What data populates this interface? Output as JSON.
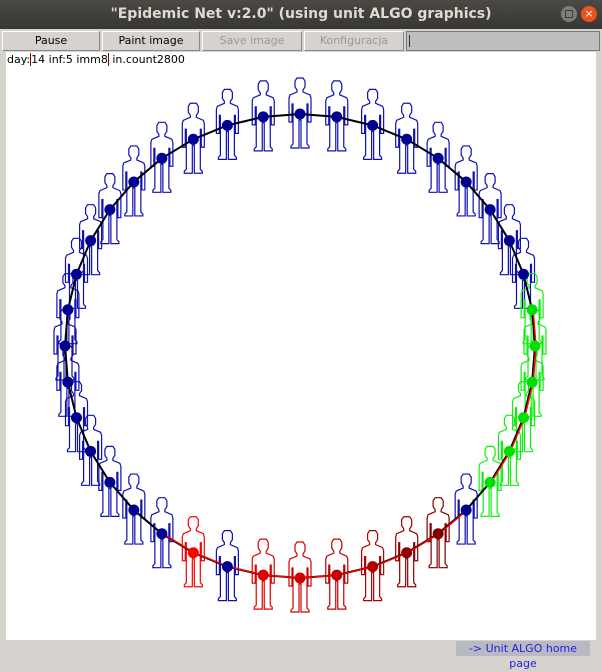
{
  "window": {
    "title": "\"Epidemic Net v:2.0\" (using unit ALGO graphics)",
    "close_glyph": "×"
  },
  "toolbar": {
    "pause_label": "Pause",
    "paint_label": "Paint image",
    "save_label": "Save image",
    "config_label": "Konfiguracja",
    "text_value": ""
  },
  "status": {
    "day_label": "day:",
    "day": "14",
    "inf": "inf:5",
    "imm": "imm8",
    "count": "in.count2800"
  },
  "footer": {
    "link": "-> Unit ALGO home page"
  },
  "colors": {
    "susceptible_outline": "#1010b0",
    "susceptible_dot": "#000090",
    "immune_outline": "#10f010",
    "immune_dot": "#00e000",
    "edge": "#000000",
    "infected_edge": "#ff0000"
  },
  "people": [
    "immune",
    "immune",
    "immune",
    "immune",
    "immune",
    "susceptible",
    "#800000",
    "#900000",
    "#b00000",
    "#c00000",
    "#d00000",
    "#e00000",
    "susceptible",
    "#ff0000",
    "susceptible",
    "susceptible",
    "susceptible",
    "susceptible",
    "susceptible",
    "susceptible",
    "susceptible",
    "susceptible",
    "susceptible",
    "susceptible",
    "susceptible",
    "susceptible",
    "susceptible",
    "susceptible",
    "susceptible",
    "susceptible",
    "susceptible",
    "susceptible",
    "susceptible",
    "susceptible",
    "susceptible",
    "susceptible",
    "susceptible",
    "susceptible",
    "susceptible",
    "immune"
  ]
}
